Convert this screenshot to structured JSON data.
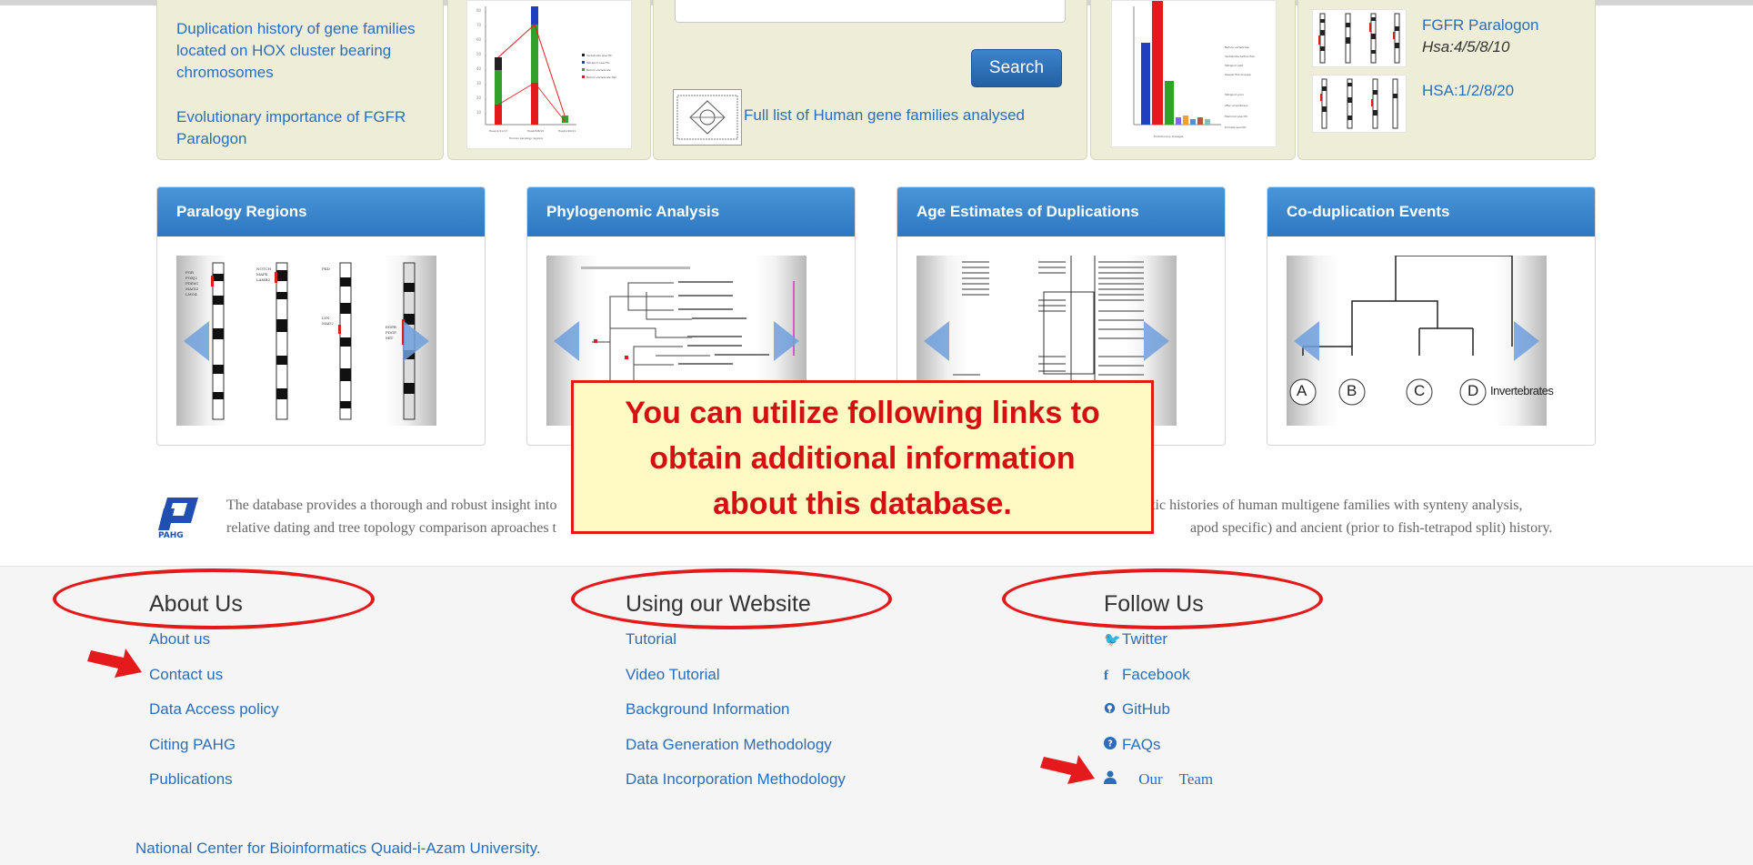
{
  "top_cards": {
    "card1_links": [
      "Duplication history of gene families located on HOX cluster bearing chromosomes",
      "Evolutionary importance of FGFR Paralogon"
    ],
    "search_button": "Search",
    "gene_families_link": "Full list of Human gene families analysed",
    "fgfr": {
      "title": "FGFR Paralogon",
      "sub": "Hsa:4/5/8/10",
      "hsa": "HSA:1/2/8/20"
    }
  },
  "panels": [
    {
      "title": "Paralogy Regions"
    },
    {
      "title": "Phylogenomic Analysis"
    },
    {
      "title": "Age Estimates of Duplications"
    },
    {
      "title": "Co-duplication Events"
    }
  ],
  "codup_labels": {
    "a": "A",
    "b": "B",
    "c": "C",
    "d": "D",
    "inv": "Invertebrates"
  },
  "logo_text": "PAHG",
  "description": {
    "line1_start": "The database provides a thorough and robust insight into",
    "line1_end": "etic histories of human multigene families with synteny analysis,",
    "line2_start": "relative dating and tree topology comparison aproaches t",
    "line2_end": "apod specific) and ancient (prior to fish-tetrapod split) history."
  },
  "callout": {
    "line1": "You can utilize following links to",
    "line2": "obtain additional information",
    "line3": "about this database."
  },
  "footer": {
    "about": {
      "heading": "About Us",
      "links": [
        "About us",
        "Contact us",
        "Data Access policy",
        "Citing PAHG",
        "Publications"
      ]
    },
    "website": {
      "heading": "Using our Website",
      "links": [
        "Tutorial",
        "Video Tutorial",
        "Background Information",
        "Data Generation Methodology",
        "Data Incorporation Methodology"
      ]
    },
    "follow": {
      "heading": "Follow Us",
      "links": [
        {
          "icon": "twitter-icon",
          "label": "Twitter"
        },
        {
          "icon": "facebook-icon",
          "label": "Facebook"
        },
        {
          "icon": "github-icon",
          "label": "GitHub"
        },
        {
          "icon": "question-icon",
          "label": "FAQs"
        },
        {
          "icon": "user-icon",
          "label": "Our Team"
        }
      ]
    },
    "institution": "National Center for Bioinformatics Quaid-i-Azam University."
  },
  "colors": {
    "link": "#2a6ebb",
    "panel_header": "#3a86cc",
    "annotation_red": "#e41a1a",
    "callout_bg": "#fff9c4"
  }
}
